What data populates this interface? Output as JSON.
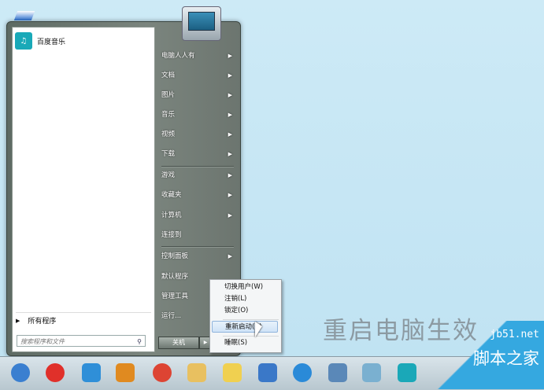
{
  "start_menu": {
    "pinned": [
      {
        "label": "百度音乐",
        "icon": "baidu-music-icon"
      }
    ],
    "all_programs": "所有程序",
    "search_placeholder": "搜索程序和文件",
    "right_items": [
      {
        "label": "电脑人人有",
        "arrow": true
      },
      {
        "label": "文档",
        "arrow": true
      },
      {
        "label": "图片",
        "arrow": true
      },
      {
        "label": "音乐",
        "arrow": true
      },
      {
        "label": "视频",
        "arrow": true
      },
      {
        "label": "下载",
        "arrow": true
      },
      {
        "label": "游戏",
        "arrow": true
      },
      {
        "label": "收藏夹",
        "arrow": true
      },
      {
        "label": "计算机",
        "arrow": true
      },
      {
        "label": "连接到",
        "arrow": false
      },
      {
        "label": "控制面板",
        "arrow": true
      },
      {
        "label": "默认程序",
        "arrow": false
      },
      {
        "label": "管理工具",
        "arrow": false
      },
      {
        "label": "运行...",
        "arrow": false
      }
    ],
    "shutdown": "关机"
  },
  "shutdown_menu": {
    "items": [
      "切换用户(W)",
      "注销(L)",
      "锁定(O)",
      "重新启动(R)",
      "睡眠(S)"
    ],
    "highlighted": "重新启动(R)"
  },
  "watermark": "重启电脑生效",
  "site_logo": {
    "url": "jb51.net",
    "name": "脚本之家"
  },
  "taskbar": {
    "icons": [
      "start-orb-icon",
      "jiang-icon",
      "internet-explorer-icon",
      "media-player-icon",
      "chrome-icon",
      "file-explorer-icon",
      "sticky-notes-icon",
      "document-icon",
      "browser-icon",
      "remote-desktop-icon",
      "pinwheel-icon",
      "baidu-music-icon"
    ]
  }
}
